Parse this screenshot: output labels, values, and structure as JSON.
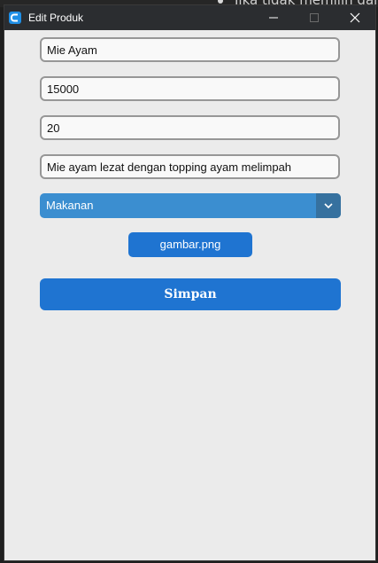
{
  "window": {
    "title": "Edit Produk",
    "accent_color": "#1f74d1",
    "titlebar_color": "#2b2d30"
  },
  "background": {
    "text": "Jika tidak memilih gam"
  },
  "form": {
    "name_value": "Mie Ayam",
    "price_value": "15000",
    "stock_value": "20",
    "description_value": "Mie ayam lezat dengan topping ayam melimpah",
    "category_selected": "Makanan",
    "image_button_label": "gambar.png",
    "save_label": "Simpan"
  },
  "icons": {
    "app": "app-c-icon",
    "minimize": "minimize-icon",
    "maximize": "maximize-icon",
    "close": "close-icon",
    "dropdown": "chevron-down-icon"
  }
}
